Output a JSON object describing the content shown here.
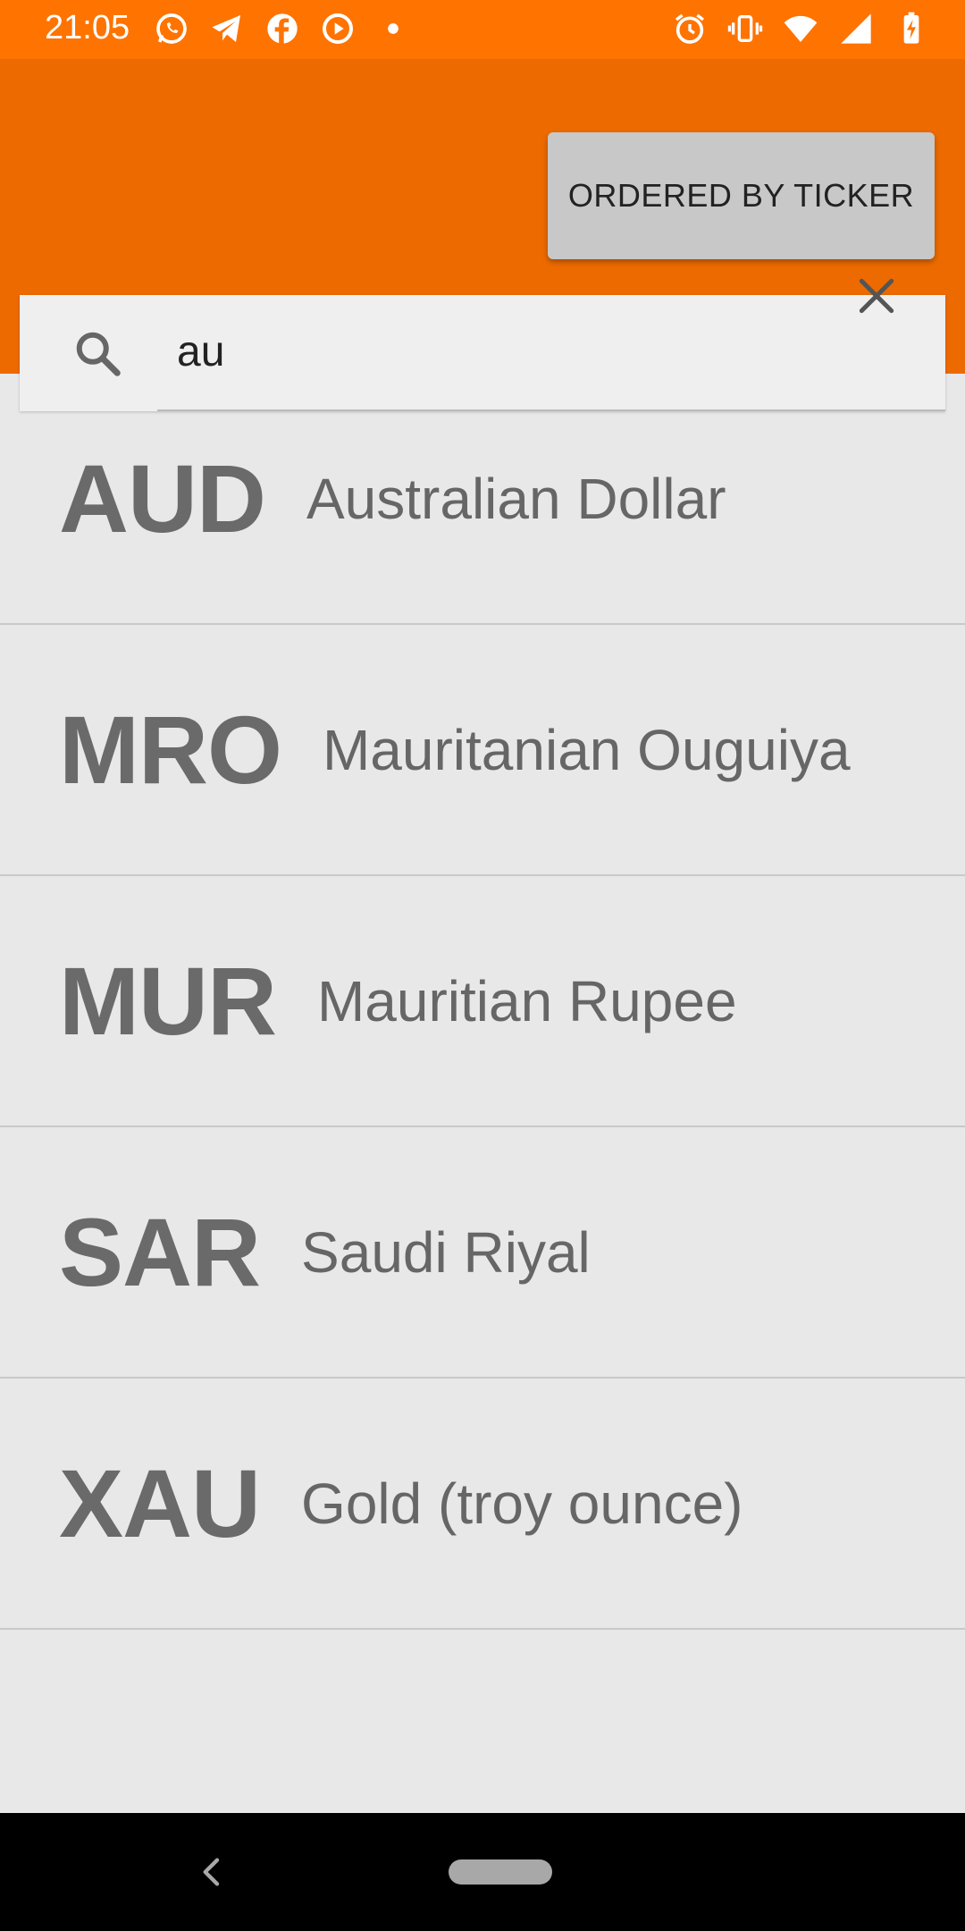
{
  "status_bar": {
    "time": "21:05",
    "left_icons": [
      "whatsapp-icon",
      "telegram-icon",
      "facebook-icon",
      "play-icon",
      "dot-icon"
    ],
    "right_icons": [
      "alarm-icon",
      "vibrate-icon",
      "wifi-icon",
      "signal-icon",
      "battery-icon"
    ]
  },
  "header": {
    "sort_button_label": "ORDERED BY TICKER",
    "accent_color": "#ec6a00"
  },
  "search": {
    "value": "au"
  },
  "currencies": [
    {
      "ticker": "AUD",
      "name": "Australian Dollar"
    },
    {
      "ticker": "MRO",
      "name": "Mauritanian Ouguiya"
    },
    {
      "ticker": "MUR",
      "name": "Mauritian Rupee"
    },
    {
      "ticker": "SAR",
      "name": "Saudi Riyal"
    },
    {
      "ticker": "XAU",
      "name": "Gold (troy ounce)"
    }
  ]
}
